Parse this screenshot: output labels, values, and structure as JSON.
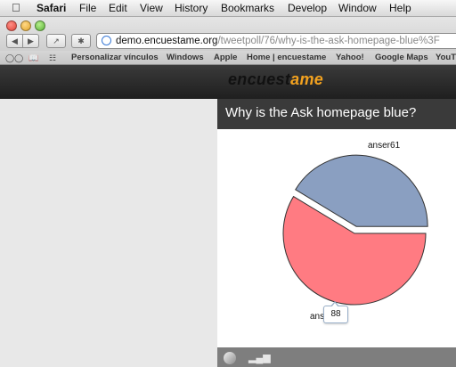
{
  "menubar": {
    "app": "Safari",
    "items": [
      "File",
      "Edit",
      "View",
      "History",
      "Bookmarks",
      "Develop",
      "Window",
      "Help"
    ]
  },
  "toolbar": {
    "url_host": "demo.encuestame.org",
    "url_path": "/tweetpoll/76/why-is-the-ask-homepage-blue%3F"
  },
  "bookmarks": [
    "Personalizar vínculos",
    "Windows",
    "Apple",
    "Home | encuestame",
    "Yahoo!",
    "Google Maps",
    "YouT"
  ],
  "site": {
    "logo_part1": "encuest",
    "logo_part2": "ame"
  },
  "poll": {
    "title": "Why is the Ask homepage blue?",
    "tooltip_value": "88",
    "colors": {
      "slice_a": "#ff7b82",
      "slice_b": "#8a9fc1"
    }
  },
  "chart_data": {
    "type": "pie",
    "slices": [
      {
        "label": "ans",
        "value": 88
      },
      {
        "label": "anser61",
        "value": 62
      }
    ]
  }
}
